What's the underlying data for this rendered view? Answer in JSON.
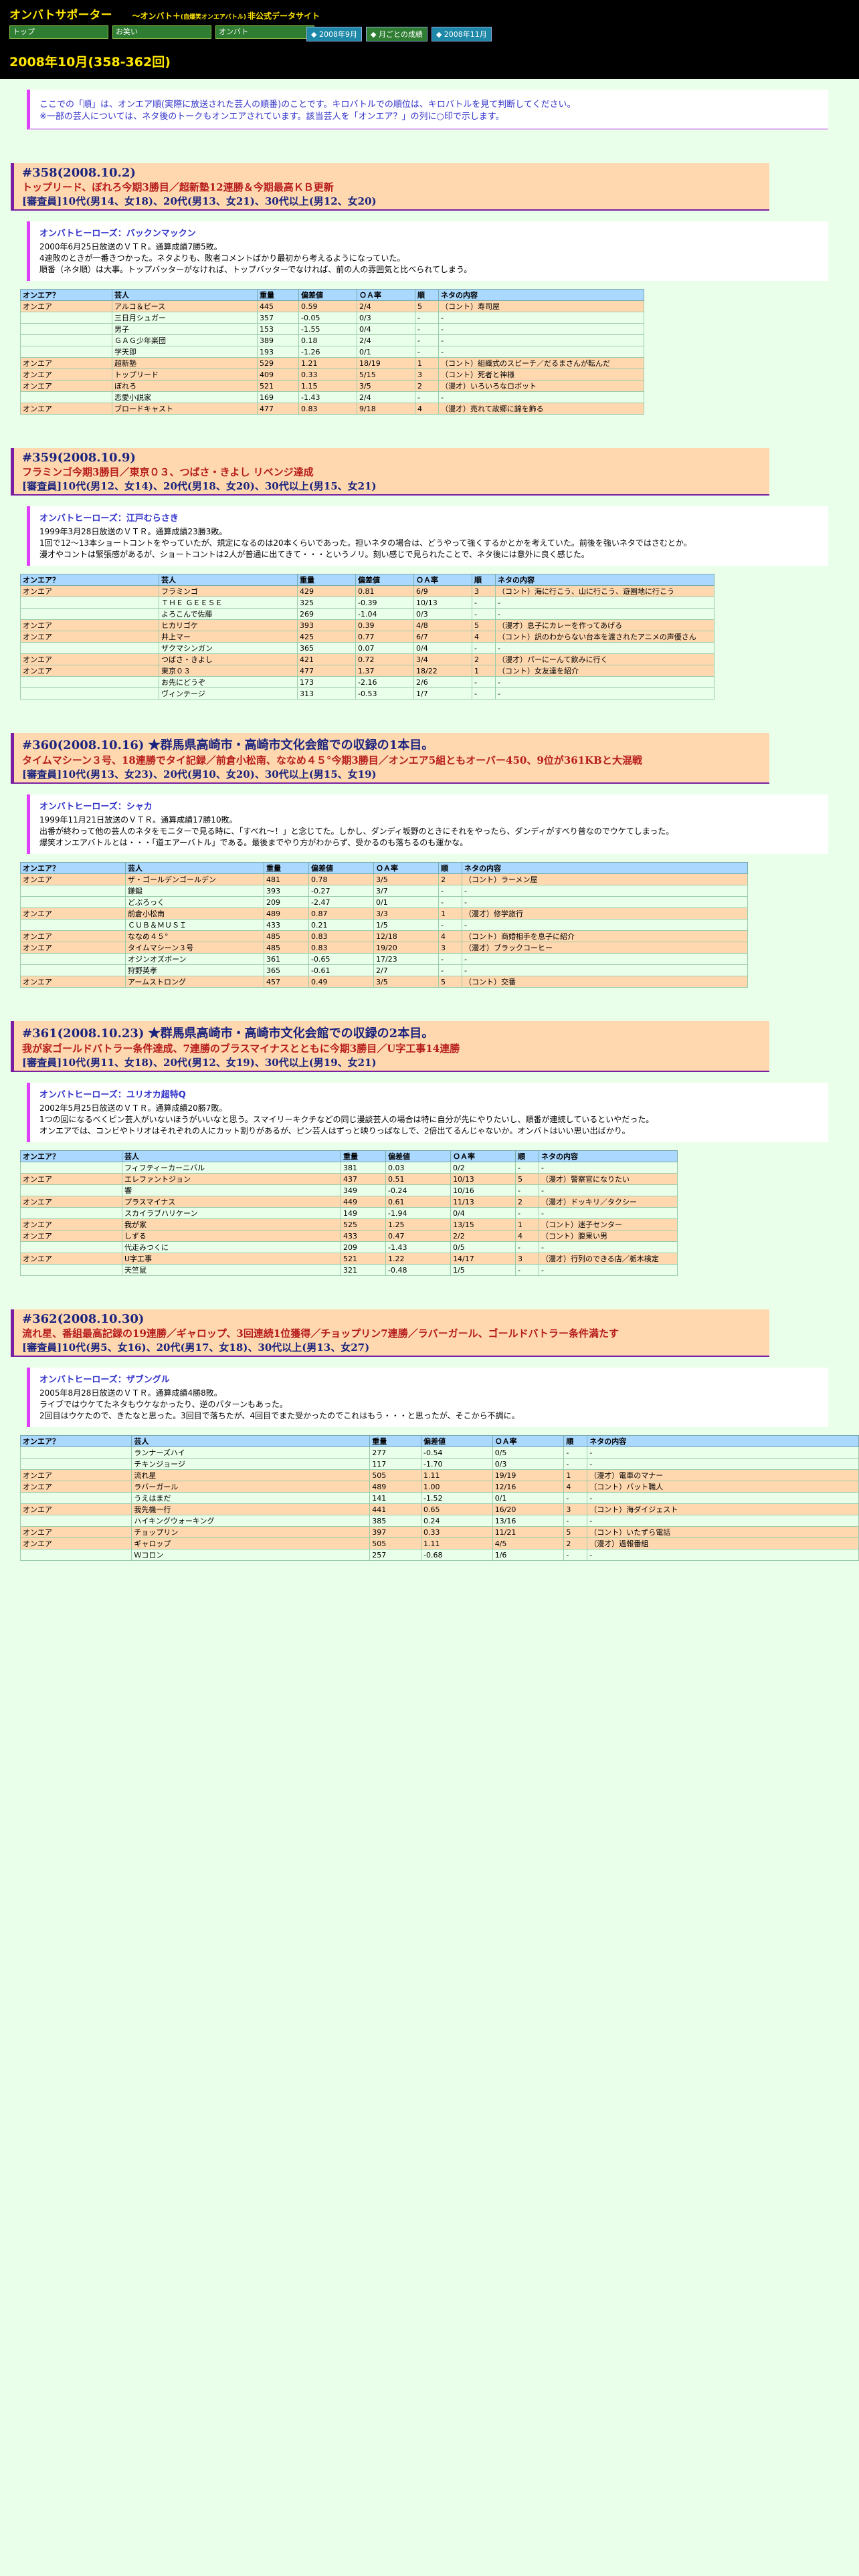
{
  "header": {
    "site_title": "オンバトサポーター",
    "site_sub": "〜オンバト＋",
    "site_tiny": "(自爆笑オンエアバトル)",
    "site_tail": "非公式データサイト",
    "nav": [
      "トップ",
      "お笑い",
      "オンバト",
      ""
    ],
    "buttons": [
      "2008年9月",
      "月ごとの成績",
      "2008年11月"
    ],
    "page_title": "2008年10月(358-362回)"
  },
  "notice": [
    "ここでの「順」は、オンエア順(実際に放送された芸人の順番)のことです。キロバトルでの順位は、キロバトルを見て判断してください。",
    "※一部の芸人については、ネタ後のトークもオンエアされています。該当芸人を「オンエア？」の列に○印で示します。"
  ],
  "colors": {
    "header_bg": "#000000",
    "title_yellow": "#ffe600",
    "oa_row": "#ffd8b0",
    "page_bg": "#eaffea",
    "accent": "#e040fb"
  },
  "episodes": [
    {
      "title": "#358(2008.10.2)",
      "subtitle": "トップリード、ぼれろ今期3勝目／超新塾12連勝＆今期最高ＫＢ更新",
      "jury": "[審査員]10代(男14、女18)、20代(男13、女21)、30代以上(男12、女20)",
      "hero_name": "オンバトヒーローズ：バックンマックン",
      "hero_text": [
        "2000年6月25日放送のＶＴＲ。通算成績7勝5敗。",
        "4連敗のときが一番きつかった。ネタよりも、敗者コメントばかり最初から考えるようになっていた。",
        "順番（ネタ順）は大事。トップバッターがなければ、トップバッターでなければ、前の人の雰囲気と比べられてしまう。"
      ],
      "widths": [
        130,
        210,
        55,
        80,
        80,
        28,
        300
      ],
      "headers": [
        "オンエア？",
        "芸人",
        "重量",
        "偏差値",
        "ＯＡ率",
        "順",
        "ネタの内容"
      ],
      "rows": [
        [
          "オンエア",
          "アルコ＆ピース",
          "445",
          "0.59",
          "2/4",
          "5",
          "（コント）寿司屋"
        ],
        [
          "",
          "三日月シュガー",
          "357",
          "-0.05",
          "0/3",
          "-",
          "-"
        ],
        [
          "",
          "男子",
          "153",
          "-1.55",
          "0/4",
          "-",
          "-"
        ],
        [
          "",
          "ＧＡＧ少年楽団",
          "389",
          "0.18",
          "2/4",
          "-",
          "-"
        ],
        [
          "",
          "学天即",
          "193",
          "-1.26",
          "0/1",
          "-",
          "-"
        ],
        [
          "オンエア",
          "超新塾",
          "529",
          "1.21",
          "18/19",
          "1",
          "（コント）組織式のスピーチ／だるまさんが転んだ"
        ],
        [
          "オンエア",
          "トップリード",
          "409",
          "0.33",
          "5/15",
          "3",
          "（コント）死者と神様"
        ],
        [
          "オンエア",
          "ぼれろ",
          "521",
          "1.15",
          "3/5",
          "2",
          "（漫才）いろいろなロボット"
        ],
        [
          "",
          "恋愛小説家",
          "169",
          "-1.43",
          "2/4",
          "-",
          "-"
        ],
        [
          "オンエア",
          "ブロードキャスト",
          "477",
          "0.83",
          "9/18",
          "4",
          "（漫才）売れて故郷に錦を飾る"
        ]
      ]
    },
    {
      "title": "#359(2008.10.9)",
      "subtitle": "フラミンゴ今期3勝目／東京０３、つばさ・きよし リベンジ達成",
      "jury": "[審査員]10代(男12、女14)、20代(男18、女20)、30代以上(男15、女21)",
      "hero_name": "オンバトヒーローズ：江戸むらさき",
      "hero_text": [
        "1999年3月28日放送のＶＴＲ。通算成績23勝3敗。",
        "1回で12〜13本ショートコントをやっていたが、規定になるのは20本くらいであった。担いネタの場合は、どうやって強くするかとかを考えていた。前後を強いネタではさむとか。",
        "漫才やコントは緊張感があるが、ショートコントは2人が普通に出てきて・・・というノリ。刻い感じで見られたことで、ネタ後には意外に良く感じた。"
      ],
      "widths": [
        200,
        200,
        80,
        80,
        80,
        28,
        320
      ],
      "headers": [
        "オンエア？",
        "芸人",
        "重量",
        "偏差値",
        "ＯＡ率",
        "順",
        "ネタの内容"
      ],
      "rows": [
        [
          "オンエア",
          "フラミンゴ",
          "429",
          "0.81",
          "6/9",
          "3",
          "（コント）海に行こう、山に行こう、遊園地に行こう"
        ],
        [
          "",
          "ＴＨＥ ＧＥＥＳＥ",
          "325",
          "-0.39",
          "10/13",
          "-",
          "-"
        ],
        [
          "",
          "よろこんで佐藤",
          "269",
          "-1.04",
          "0/3",
          "-",
          "-"
        ],
        [
          "オンエア",
          "ヒカリゴケ",
          "393",
          "0.39",
          "4/8",
          "5",
          "（漫才）息子にカレーを作ってあげる"
        ],
        [
          "オンエア",
          "井上マー",
          "425",
          "0.77",
          "6/7",
          "4",
          "（コント）訳のわからない台本を渡されたアニメの声優さん"
        ],
        [
          "",
          "ザクマシンガン",
          "365",
          "0.07",
          "0/4",
          "-",
          "-"
        ],
        [
          "オンエア",
          "つばさ・きよし",
          "421",
          "0.72",
          "3/4",
          "2",
          "（漫才）パーにーんて飲みに行く"
        ],
        [
          "オンエア",
          "東京０３",
          "477",
          "1.37",
          "18/22",
          "1",
          "（コント）女友達を紹介"
        ],
        [
          "",
          "お先にどうぞ",
          "173",
          "-2.16",
          "2/6",
          "-",
          "-"
        ],
        [
          "",
          "ヴィンテージ",
          "313",
          "-0.53",
          "1/7",
          "-",
          "-"
        ]
      ]
    },
    {
      "title": "#360(2008.10.16) ★群馬県高崎市・高崎市文化会館での収録の1本目。",
      "subtitle": "タイムマシーン３号、18連勝でタイ記録／前倉小松南、ななめ４５°今期3勝目／オンエア5組ともオーバー450、9位が361KBと大混戦",
      "jury": "[審査員]10代(男13、女23)、20代(男10、女20)、30代以上(男15、女19)",
      "hero_name": "オンバトヒーローズ：シャカ",
      "hero_text": [
        "1999年11月21日放送のＶＴＲ。通算成績17勝10敗。",
        "出番が終わって他の芸人のネタをモニターで見る時に、「すべれ〜！」と念じてた。しかし、ダンディ坂野のときにそれをやったら、ダンディがすべり普なのでウケてしまった。",
        "爆笑オンエアバトルとは・・・「道エアーバトル」である。最後までやり方がわからず、受かるのも落ちるのも運かな。"
      ],
      "widths": [
        150,
        200,
        60,
        90,
        90,
        28,
        420
      ],
      "headers": [
        "オンエア？",
        "芸人",
        "重量",
        "偏差値",
        "ＯＡ率",
        "順",
        "ネタの内容"
      ],
      "rows": [
        [
          "オンエア",
          "ザ・ゴールデンゴールデン",
          "481",
          "0.78",
          "3/5",
          "2",
          "（コント）ラーメン屋"
        ],
        [
          "",
          "鎌鍛",
          "393",
          "-0.27",
          "3/7",
          "-",
          "-"
        ],
        [
          "",
          "どぶろっく",
          "209",
          "-2.47",
          "0/1",
          "-",
          "-"
        ],
        [
          "オンエア",
          "前倉小松南",
          "489",
          "0.87",
          "3/3",
          "1",
          "（漫才）修学旅行"
        ],
        [
          "",
          "ＣＵＢ＆ＭＵＳＩ",
          "433",
          "0.21",
          "1/5",
          "-",
          "-"
        ],
        [
          "オンエア",
          "ななめ４５°",
          "485",
          "0.83",
          "12/18",
          "4",
          "（コント）商婚相手を息子に紹介"
        ],
        [
          "オンエア",
          "タイムマシーン３号",
          "485",
          "0.83",
          "19/20",
          "3",
          "（漫才）ブラックコーヒー"
        ],
        [
          "",
          "オジンオズボーン",
          "361",
          "-0.65",
          "17/23",
          "-",
          "-"
        ],
        [
          "",
          "狩野英孝",
          "365",
          "-0.61",
          "2/7",
          "-",
          "-"
        ],
        [
          "オンエア",
          "アームストロング",
          "457",
          "0.49",
          "3/5",
          "5",
          "（コント）交番"
        ]
      ]
    },
    {
      "title": "#361(2008.10.23) ★群馬県高崎市・高崎市文化会館での収録の2本目。",
      "subtitle": "我が家ゴールドバトラー条件達成、7連勝のブラスマイナスとともに今期3勝目／U字工事14連勝",
      "jury": "[審査員]10代(男11、女18)、20代(男12、女19)、30代以上(男19、女21)",
      "hero_name": "オンバトヒーローズ：ユリオカ超特Q",
      "hero_text": [
        "2002年5月25日放送のＶＴＲ。通算成績20勝7敗。",
        "1つの回になるべくピン芸人がいないほうがいいなと思う。スマイリーキクチなどの同じ漫談芸人の場合は特に自分が先にやりたいし、順番が連続しているといやだった。",
        "オンエアでは、コンビやトリオはそれぞれの人にカット割りがあるが、ピン芸人はずっと映りっぱなしで、2倍出てるんじゃないか。オンバトはいい思い出ばかり。"
      ],
      "widths": [
        145,
        320,
        60,
        90,
        90,
        28,
        200
      ],
      "headers": [
        "オンエア？",
        "芸人",
        "重量",
        "偏差値",
        "ＯＡ率",
        "順",
        "ネタの内容"
      ],
      "rows": [
        [
          "",
          "フィフティーカーニバル",
          "381",
          "0.03",
          "0/2",
          "-",
          "-"
        ],
        [
          "オンエア",
          "エレファントジョン",
          "437",
          "0.51",
          "10/13",
          "5",
          "（漫才）警察官になりたい"
        ],
        [
          "",
          "響",
          "349",
          "-0.24",
          "10/16",
          "-",
          "-"
        ],
        [
          "オンエア",
          "プラスマイナス",
          "449",
          "0.61",
          "11/13",
          "2",
          "（漫才）ドッキリ／タクシー"
        ],
        [
          "",
          "スカイラブハリケーン",
          "149",
          "-1.94",
          "0/4",
          "-",
          "-"
        ],
        [
          "オンエア",
          "我が家",
          "525",
          "1.25",
          "13/15",
          "1",
          "（コント）迷子センター"
        ],
        [
          "オンエア",
          "しずる",
          "433",
          "0.47",
          "2/2",
          "4",
          "（コント）腹果い男"
        ],
        [
          "",
          "代走みつくに",
          "209",
          "-1.43",
          "0/5",
          "-",
          "-"
        ],
        [
          "オンエア",
          "U字工事",
          "521",
          "1.22",
          "14/17",
          "3",
          "（漫才）行列のできる店／栃木検定"
        ],
        [
          "",
          "天竺鼠",
          "321",
          "-0.48",
          "1/5",
          "-",
          "-"
        ]
      ]
    },
    {
      "title": "#362(2008.10.30)",
      "subtitle": "流れ星、番組最高記録の19連勝／ギャロップ、3回連続1位獲得／チョップリン7連勝／ラバーガール、ゴールドバトラー条件満たす",
      "jury": "[審査員]10代(男5、女16)、20代(男17、女18)、30代以上(男13、女27)",
      "hero_name": "オンバトヒーローズ：ザブングル",
      "hero_text": [
        "2005年8月28日放送のＶＴＲ。通算成績4勝8敗。",
        "ライブではウケてたネタもウケなかったり、逆のパターンもあった。",
        "2回目はウケたので、きたなと思った。3回目で落ちたが、4回目でまた受かったのでこれはもう・・・と思ったが、そこから不調に。"
      ],
      "widths": [
        160,
        350,
        70,
        100,
        100,
        28,
        400
      ],
      "headers": [
        "オンエア？",
        "芸人",
        "重量",
        "偏差値",
        "ＯＡ率",
        "順",
        "ネタの内容"
      ],
      "rows": [
        [
          "",
          "ランナーズハイ",
          "277",
          "-0.54",
          "0/5",
          "-",
          "-"
        ],
        [
          "",
          "チキンジョージ",
          "117",
          "-1.70",
          "0/3",
          "-",
          "-"
        ],
        [
          "オンエア",
          "流れ星",
          "505",
          "1.11",
          "19/19",
          "1",
          "（漫才）電車のマナー"
        ],
        [
          "オンエア",
          "ラバーガール",
          "489",
          "1.00",
          "12/16",
          "4",
          "（コント）バット職人"
        ],
        [
          "",
          "うえはまだ",
          "141",
          "-1.52",
          "0/1",
          "-",
          "-"
        ],
        [
          "オンエア",
          "我先機一行",
          "441",
          "0.65",
          "16/20",
          "3",
          "（コント）海ダイジェスト"
        ],
        [
          "",
          "ハイキングウォーキング",
          "385",
          "0.24",
          "13/16",
          "-",
          "-"
        ],
        [
          "オンエア",
          "チョップリン",
          "397",
          "0.33",
          "11/21",
          "5",
          "（コント）いたずら電話"
        ],
        [
          "オンエア",
          "ギャロップ",
          "505",
          "1.11",
          "4/5",
          "2",
          "（漫才）過報番組"
        ],
        [
          "",
          "Ｗコロン",
          "257",
          "-0.68",
          "1/6",
          "-",
          "-"
        ]
      ]
    }
  ]
}
